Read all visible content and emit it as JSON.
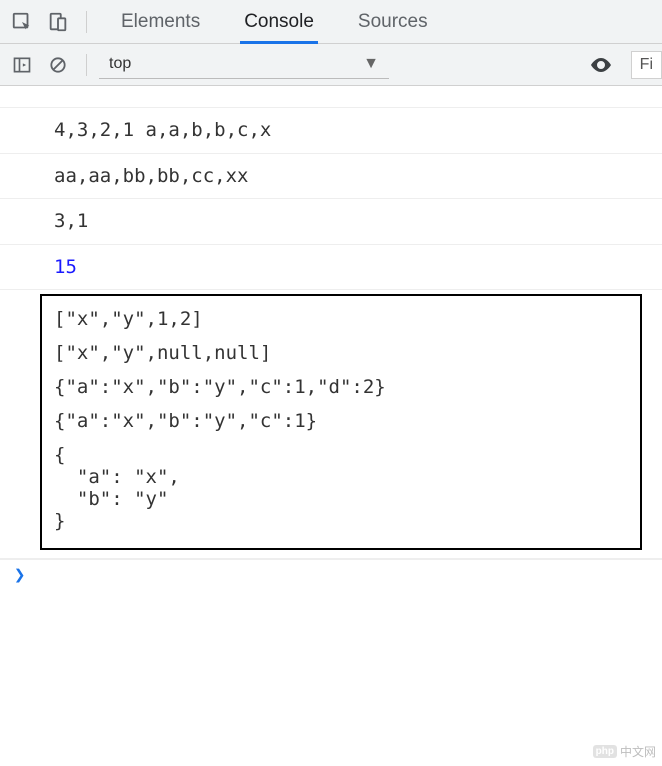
{
  "tabs": {
    "elements": "Elements",
    "console": "Console",
    "sources": "Sources"
  },
  "toolbar": {
    "context": "top",
    "filter_placeholder": "Fi"
  },
  "logs": {
    "line1": "4,3,2,1 a,a,b,b,c,x",
    "line2": "aa,aa,bb,bb,cc,xx",
    "line3": "3,1",
    "line4": "15"
  },
  "boxed": {
    "l1": "[\"x\",\"y\",1,2]",
    "l2": "[\"x\",\"y\",null,null]",
    "l3": "{\"a\":\"x\",\"b\":\"y\",\"c\":1,\"d\":2}",
    "l4": "{\"a\":\"x\",\"b\":\"y\",\"c\":1}",
    "l5": "{\n  \"a\": \"x\",\n  \"b\": \"y\"\n}"
  },
  "watermark": {
    "php": "php",
    "zh": "中文网"
  }
}
